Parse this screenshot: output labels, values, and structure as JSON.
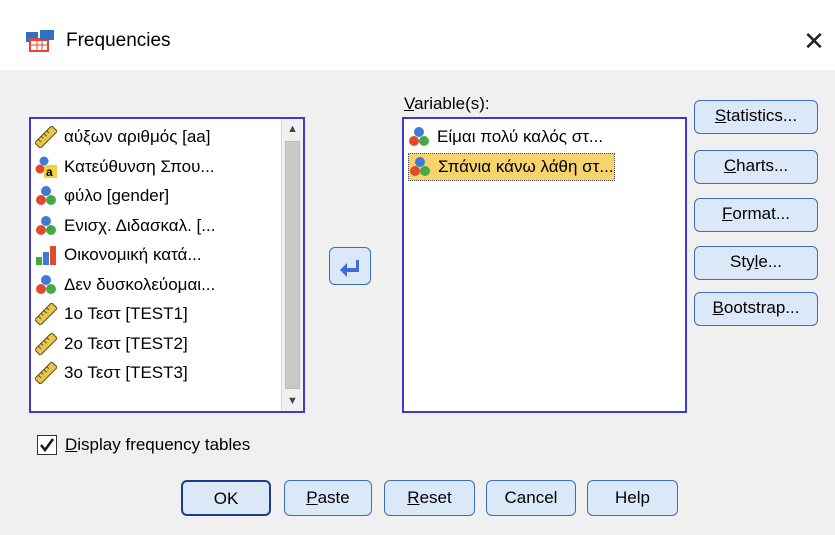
{
  "window": {
    "title": "Frequencies",
    "close_glyph": "✕"
  },
  "variable_label_prefix": "V",
  "variable_label_rest": "ariable(s):",
  "source_list": [
    {
      "label": "αύξων αριθμός [aa]",
      "icon": "scale-ruler-icon"
    },
    {
      "label": "Κατεύθυνση Σπου...",
      "icon": "nominal-string-icon"
    },
    {
      "label": "φύλο [gender]",
      "icon": "nominal-icon"
    },
    {
      "label": "Ενισχ. Διδασκαλ. [...",
      "icon": "nominal-icon"
    },
    {
      "label": "Οικονομική κατά...",
      "icon": "ordinal-icon"
    },
    {
      "label": "Δεν δυσκολεύομαι...",
      "icon": "nominal-icon"
    },
    {
      "label": "1ο Τεστ [TEST1]",
      "icon": "scale-ruler-icon"
    },
    {
      "label": "2ο Τεστ [TEST2]",
      "icon": "scale-ruler-icon"
    },
    {
      "label": "3ο Τεστ [TEST3]",
      "icon": "scale-ruler-icon"
    }
  ],
  "target_list": [
    {
      "label": "Είμαι πολύ καλός στ...",
      "icon": "nominal-icon",
      "selected": false
    },
    {
      "label": "Σπάνια κάνω λάθη στ...",
      "icon": "nominal-icon",
      "selected": true
    }
  ],
  "side_buttons": {
    "statistics": {
      "u": "S",
      "rest": "tatistics..."
    },
    "charts": {
      "u": "C",
      "rest": "harts..."
    },
    "format": {
      "u": "F",
      "rest": "ormat..."
    },
    "style_pre": "Sty",
    "style_u": "l",
    "style_post": "e...",
    "bootstrap": {
      "u": "B",
      "rest": "ootstrap..."
    }
  },
  "checkbox": {
    "checked": true,
    "u": "D",
    "rest": "isplay frequency tables"
  },
  "bottom_buttons": {
    "ok": "OK",
    "paste": {
      "u": "P",
      "rest": "aste"
    },
    "reset": {
      "u": "R",
      "rest": "eset"
    },
    "cancel": "Cancel",
    "help": "Help"
  },
  "colors": {
    "list_border": "#3b3bd1",
    "button_bg": "#dbe8f7",
    "button_border": "#3b6fbd",
    "selection": "#f7d36b",
    "arrow": "#3a6fd8"
  }
}
